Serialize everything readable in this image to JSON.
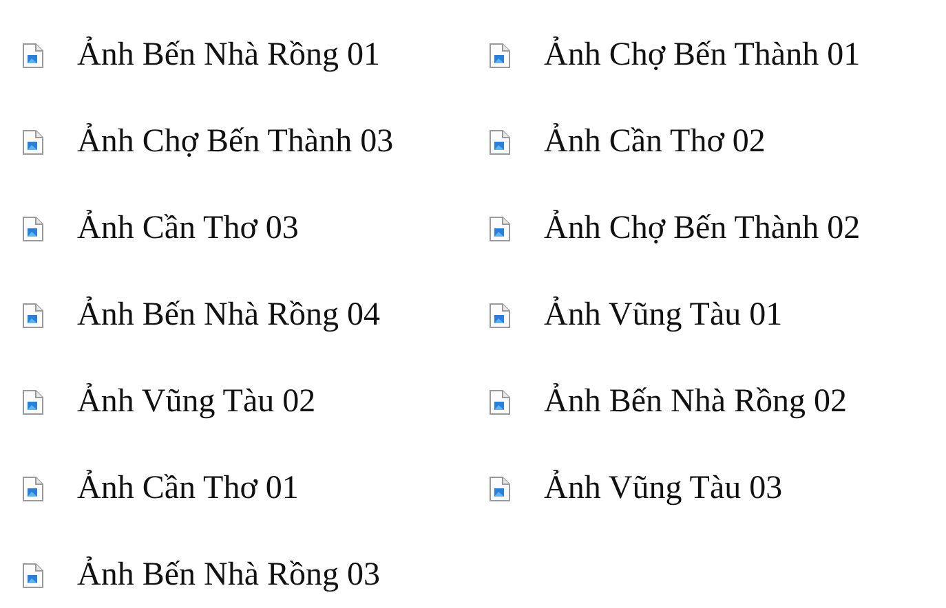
{
  "files": [
    {
      "name": "Ảnh Bến Nhà Rồng 01"
    },
    {
      "name": "Ảnh Chợ Bến Thành 01"
    },
    {
      "name": "Ảnh Chợ Bến Thành 03"
    },
    {
      "name": "Ảnh Cần Thơ 02"
    },
    {
      "name": "Ảnh Cần Thơ 03"
    },
    {
      "name": "Ảnh Chợ Bến Thành 02"
    },
    {
      "name": "Ảnh Bến Nhà Rồng 04"
    },
    {
      "name": "Ảnh Vũng Tàu 01"
    },
    {
      "name": "Ảnh Vũng Tàu 02"
    },
    {
      "name": "Ảnh Bến Nhà Rồng 02"
    },
    {
      "name": "Ảnh Cần Thơ 01"
    },
    {
      "name": "Ảnh Vũng Tàu 03"
    },
    {
      "name": "Ảnh Bến Nhà Rồng 03"
    }
  ]
}
